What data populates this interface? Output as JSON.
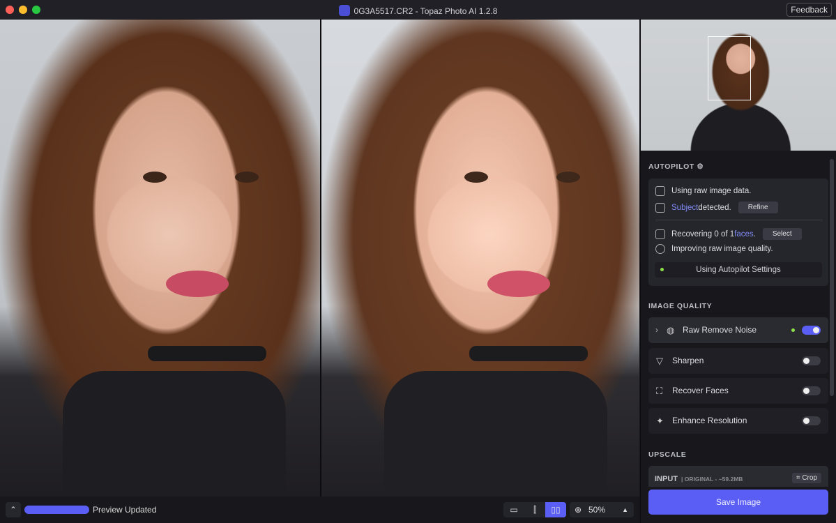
{
  "window": {
    "title": "0G3A5517.CR2 - Topaz Photo AI 1.2.8",
    "feedback_label": "Feedback"
  },
  "bottom_bar": {
    "status": "Preview Updated",
    "progress_percent": 100,
    "zoom": "50%",
    "view_modes": [
      "single-view",
      "split-view",
      "side-by-side-view"
    ],
    "active_view": "side-by-side-view"
  },
  "autopilot": {
    "heading": "AUTOPILOT",
    "raw_text": "Using raw image data.",
    "subject_link": "Subject",
    "subject_text": " detected.",
    "refine_label": "Refine",
    "faces_prefix": "Recovering 0 of 1 ",
    "faces_link": "faces",
    "faces_suffix": ".",
    "select_label": "Select",
    "improving_text": "Improving raw image quality.",
    "settings_label": "Using Autopilot Settings"
  },
  "image_quality": {
    "heading": "IMAGE QUALITY",
    "items": [
      {
        "label": "Raw Remove Noise",
        "enabled": true,
        "icon": "raw-noise-icon"
      },
      {
        "label": "Sharpen",
        "enabled": false,
        "icon": "sharpen-icon"
      },
      {
        "label": "Recover Faces",
        "enabled": false,
        "icon": "face-icon"
      },
      {
        "label": "Enhance Resolution",
        "enabled": false,
        "icon": "sparkle-icon"
      }
    ]
  },
  "upscale": {
    "heading": "UPSCALE",
    "input_label": "INPUT",
    "input_detail": "| ORIGINAL - ~59.2MB",
    "crop_label": "Crop"
  },
  "save_label": "Save Image",
  "colors": {
    "accent": "#5b5ef5",
    "link": "#7f8cf5",
    "active_dot": "#8ee04a"
  }
}
